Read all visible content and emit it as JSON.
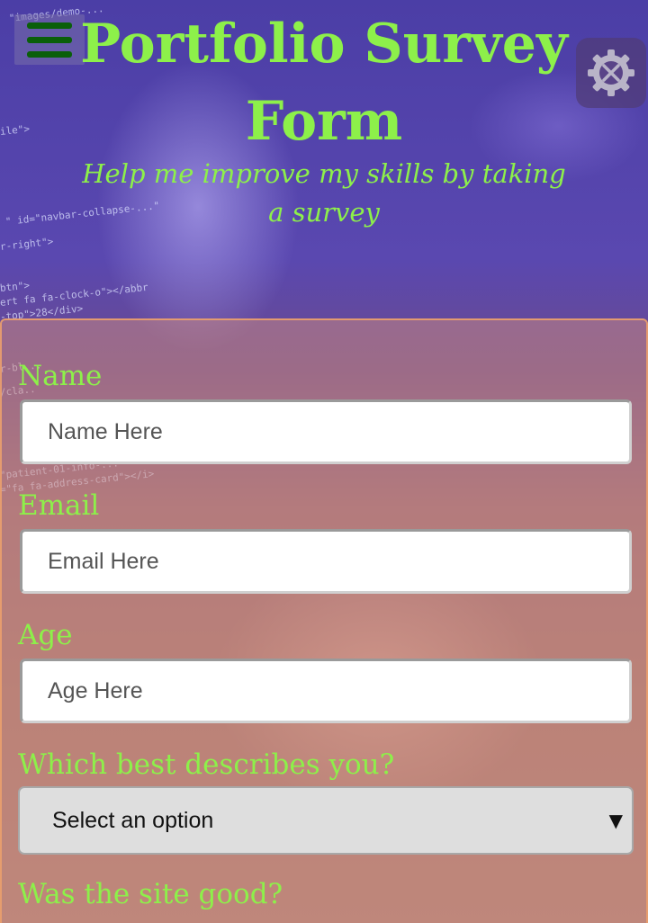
{
  "header": {
    "title": "Portfolio Survey Form",
    "subtitle": "Help me improve my skills by taking a survey",
    "menu_icon": "hamburger-menu-icon",
    "settings_icon": "settings-gear-icon"
  },
  "form": {
    "name": {
      "label": "Name",
      "placeholder": "Name Here",
      "value": ""
    },
    "email": {
      "label": "Email",
      "placeholder": "Email Here",
      "value": ""
    },
    "age": {
      "label": "Age",
      "placeholder": "Age Here",
      "value": ""
    },
    "role": {
      "label": "Which best describes you?",
      "selected": "Select an option"
    },
    "site_good": {
      "label": "Was the site good?"
    }
  },
  "colors": {
    "accent": "#8df04a",
    "menu_bars": "#0a5f0a",
    "form_border": "#eba06e"
  }
}
